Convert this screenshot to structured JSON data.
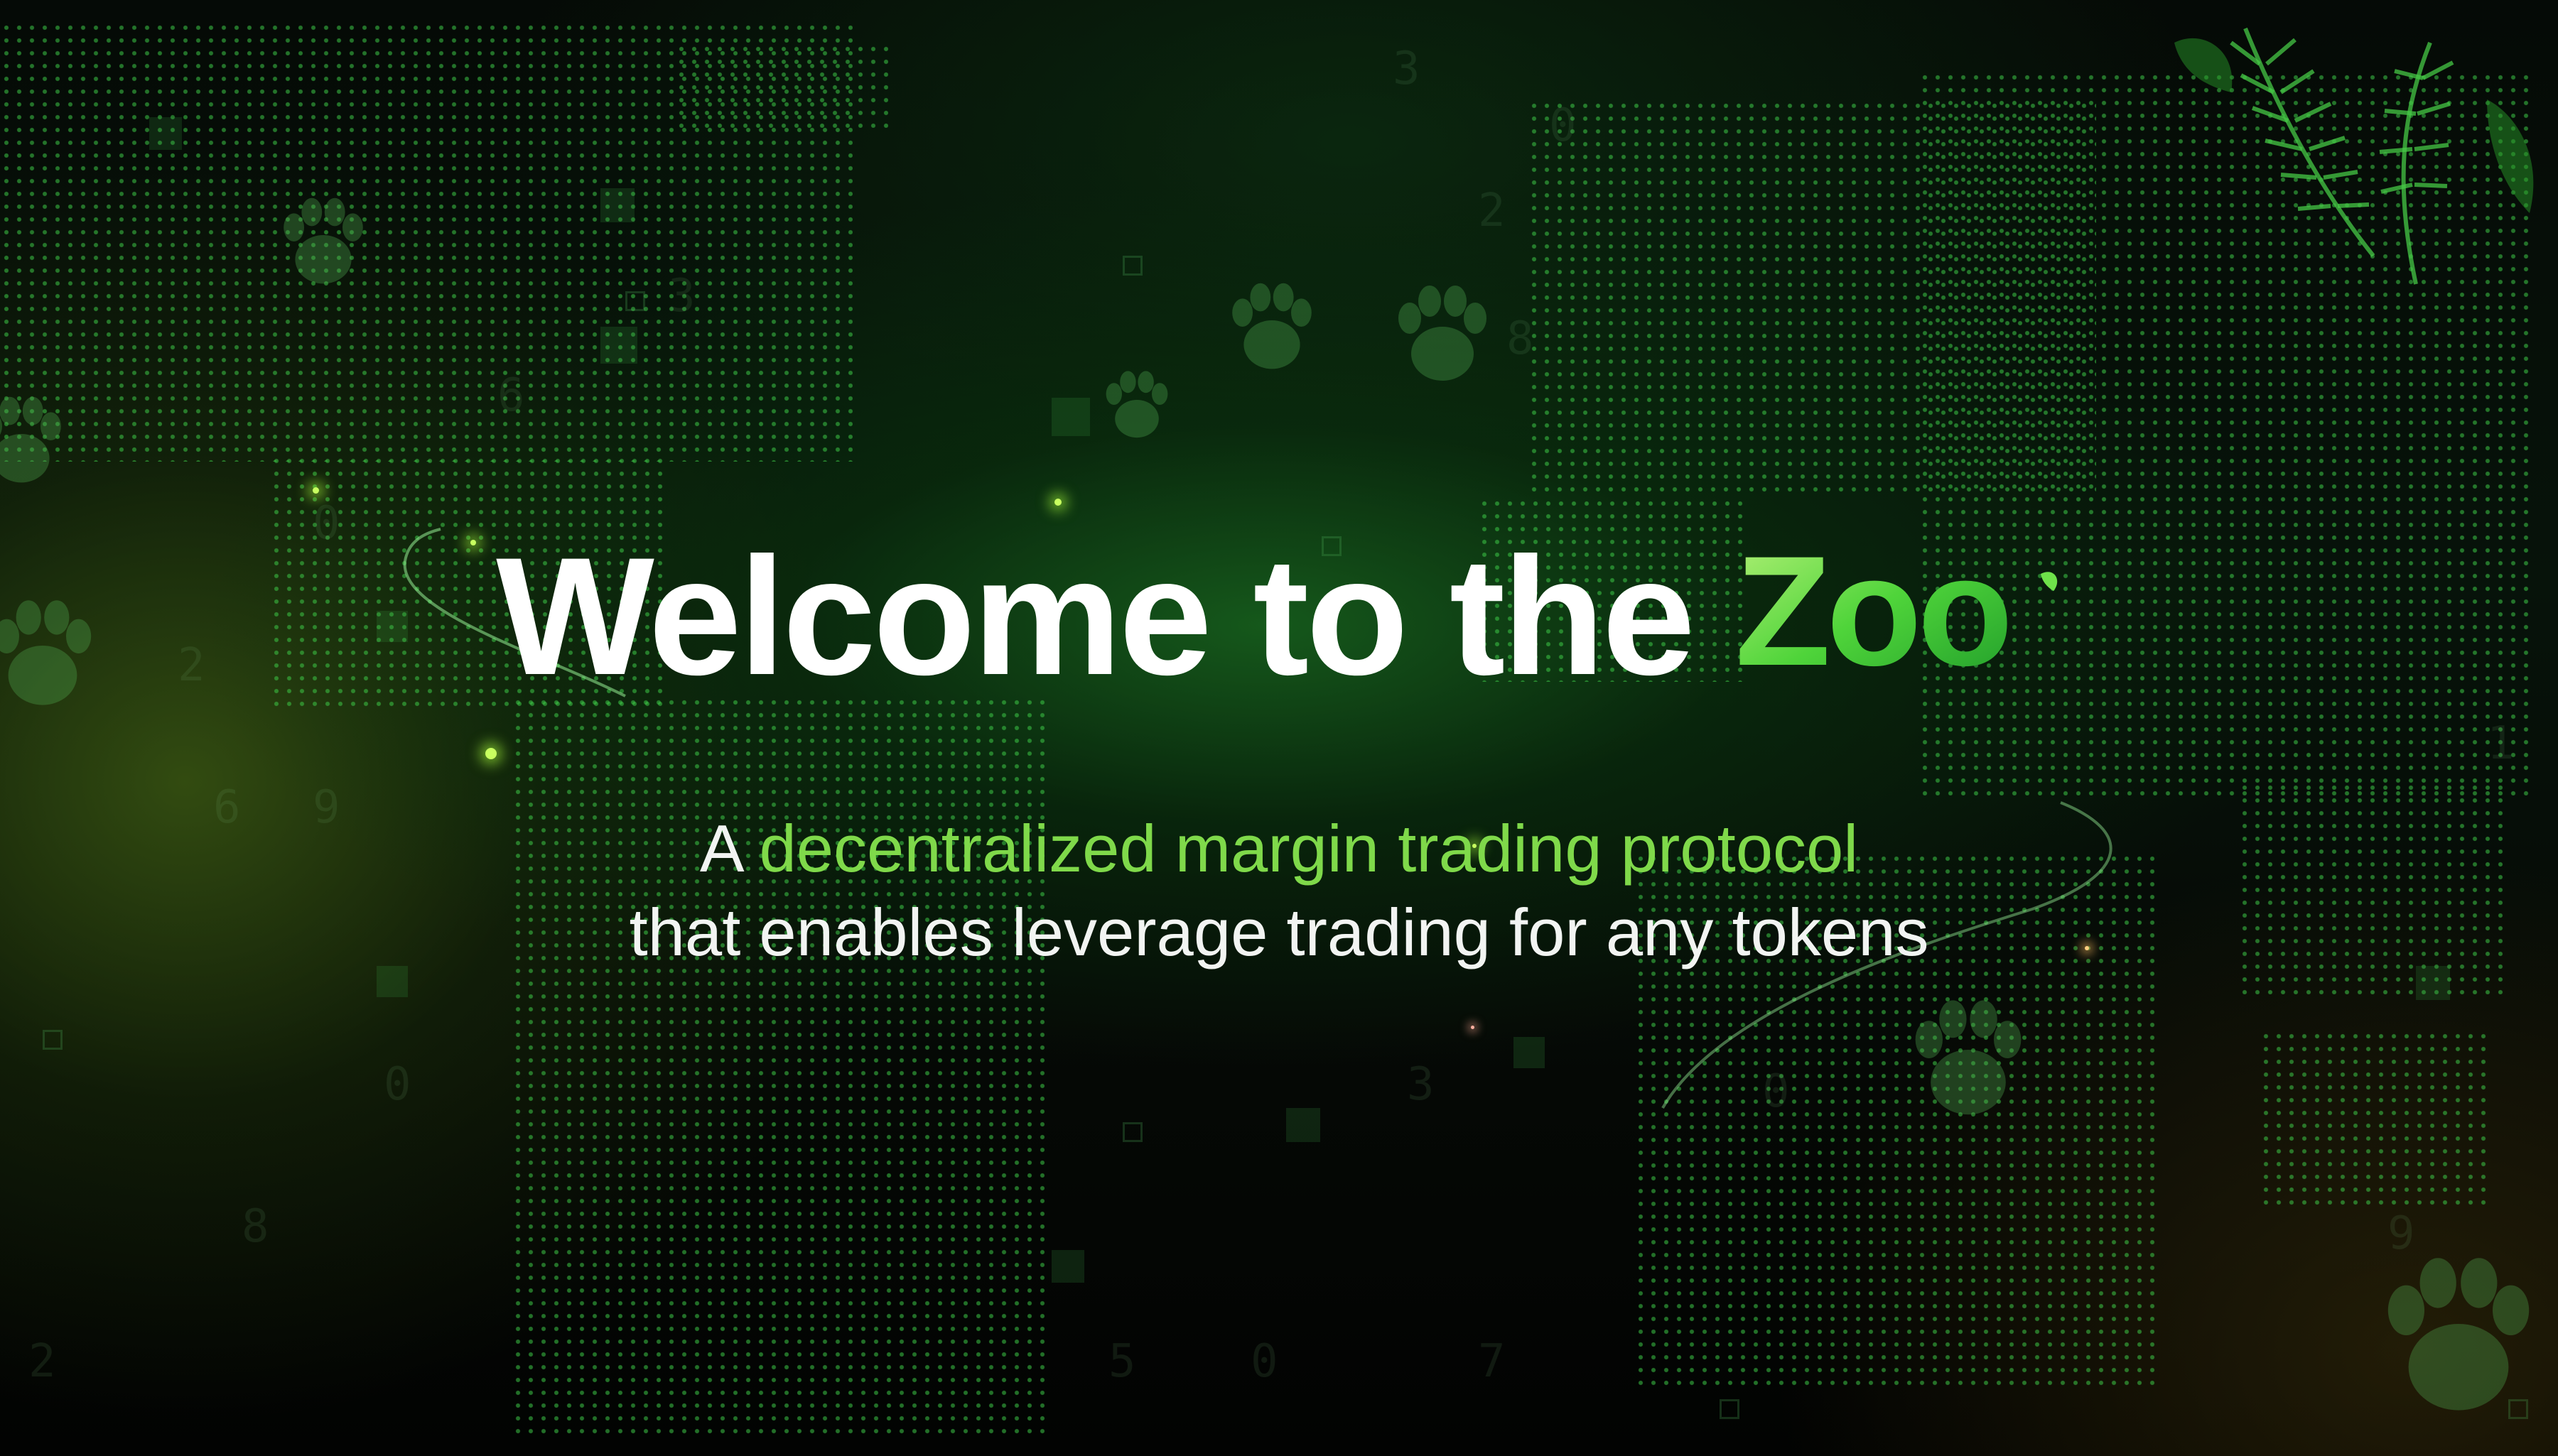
{
  "hero": {
    "headline_prefix": "Welcome to the",
    "logo_word": "Zoo",
    "subtitle_prefix": "A ",
    "subtitle_highlight": "decentralized margin trading protocol",
    "subtitle_line2": "that enables leverage trading for any tokens"
  },
  "colors": {
    "background": "#030604",
    "headline": "#ffffff",
    "accent_green": "#7fd94a",
    "logo_green": "#5ee04a"
  },
  "icons": {
    "paw": "paw-print-icon",
    "leaf": "leaf-icon"
  }
}
